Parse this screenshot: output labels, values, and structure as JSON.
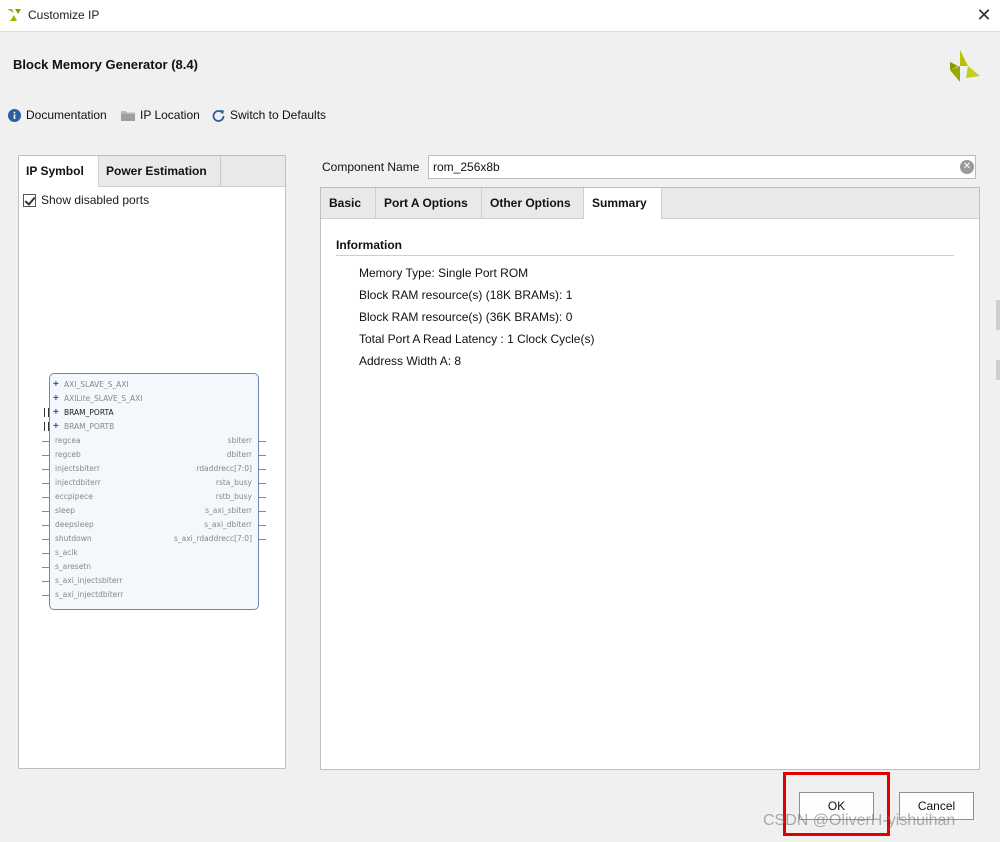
{
  "window": {
    "title": "Customize IP"
  },
  "header": {
    "title": "Block Memory Generator (8.4)"
  },
  "toolbar": {
    "documentation": "Documentation",
    "ip_location": "IP Location",
    "switch_defaults": "Switch to Defaults"
  },
  "left": {
    "tabs": [
      "IP Symbol",
      "Power Estimation"
    ],
    "show_disabled_ports": "Show disabled ports",
    "show_disabled_checked": true,
    "symbol": {
      "bus_ports": [
        "AXI_SLAVE_S_AXI",
        "AXILite_SLAVE_S_AXI",
        "BRAM_PORTA",
        "BRAM_PORTB"
      ],
      "left_ports": [
        "regcea",
        "regceb",
        "injectsbiterr",
        "injectdbiterr",
        "eccpipece",
        "sleep",
        "deepsleep",
        "shutdown",
        "s_aclk",
        "s_aresetn",
        "s_axi_injectsbiterr",
        "s_axi_injectdbiterr"
      ],
      "right_ports": [
        "sbiterr",
        "dbiterr",
        "rdaddrecc[7:0]",
        "rsta_busy",
        "rstb_busy",
        "s_axi_sbiterr",
        "s_axi_dbiterr",
        "s_axi_rdaddrecc[7:0]"
      ]
    }
  },
  "component": {
    "label": "Component Name",
    "value": "rom_256x8b"
  },
  "tabs": [
    "Basic",
    "Port A Options",
    "Other Options",
    "Summary"
  ],
  "summary": {
    "section_title": "Information",
    "lines": [
      "Memory Type: Single Port ROM",
      "Block RAM resource(s) (18K BRAMs): 1",
      "Block RAM resource(s) (36K BRAMs): 0",
      "Total Port A Read Latency : 1 Clock Cycle(s)",
      "Address Width A: 8"
    ]
  },
  "buttons": {
    "ok": "OK",
    "cancel": "Cancel"
  },
  "watermark": "CSDN @OliverH-yishuihan",
  "colors": {
    "highlight": "#e00000",
    "brand": "#a8b400"
  }
}
